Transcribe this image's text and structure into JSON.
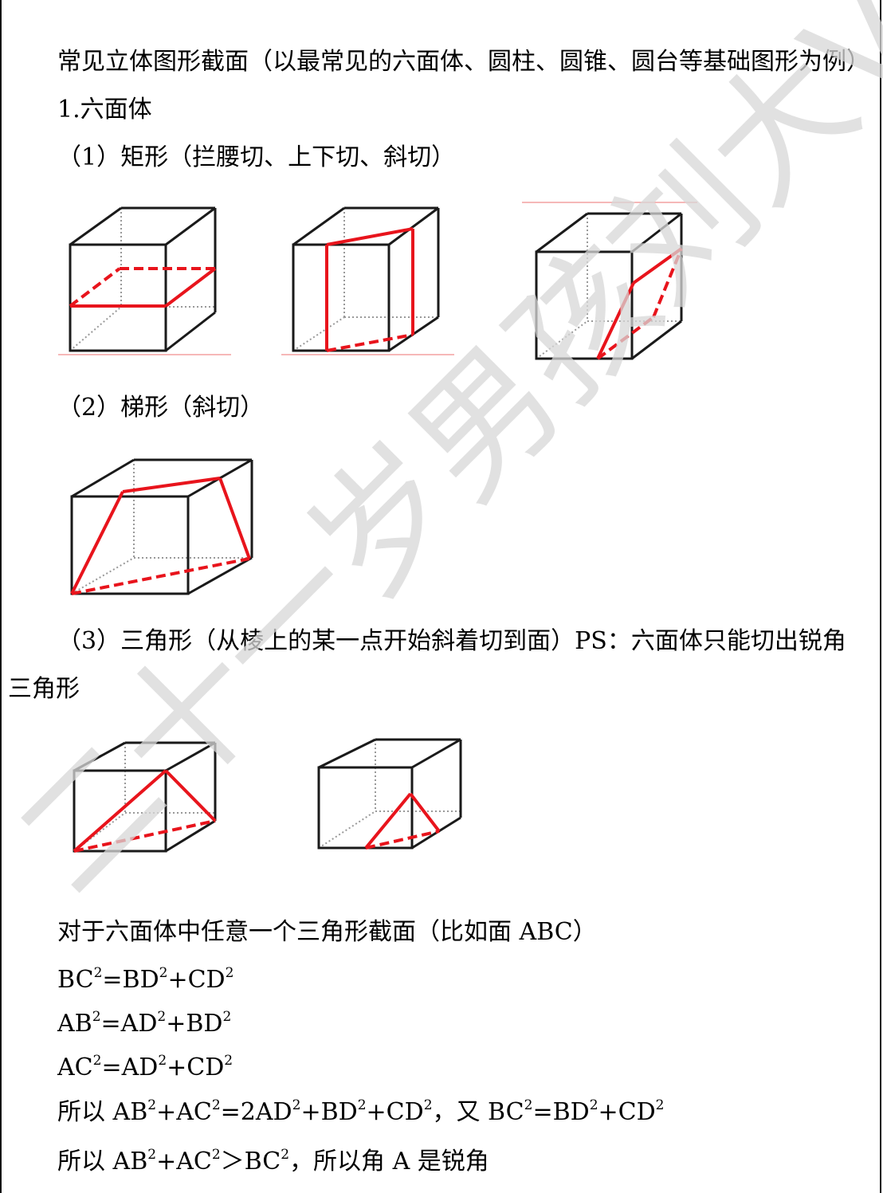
{
  "doc": {
    "title": "常见立体图形截面（以最常见的六面体、圆柱、圆锥、圆台等基础图形为例）",
    "section1": "1.六面体",
    "sub1": "（1）矩形（拦腰切、上下切、斜切）",
    "sub2": "（2）梯形（斜切）",
    "sub3_line1": "（3）三角形（从棱上的某一点开始斜着切到面）PS：六面体只能切出锐角",
    "sub3_line2": "三角形",
    "proof_intro": "对于六面体中任意一个三角形截面（比如面 ABC）",
    "eq1": [
      "BC",
      "2",
      "=BD",
      "2",
      "+CD",
      "2"
    ],
    "eq2": [
      "AB",
      "2",
      "=AD",
      "2",
      "+BD",
      "2"
    ],
    "eq3": [
      "AC",
      "2",
      "=AD",
      "2",
      "+CD",
      "2"
    ],
    "eq4": [
      "所以 AB",
      "2",
      "+AC",
      "2",
      "=2AD",
      "2",
      "+BD",
      "2",
      "+CD",
      "2",
      "，又 BC",
      "2",
      "=BD",
      "2",
      "+CD",
      "2"
    ],
    "eq5": [
      "所以 AB",
      "2",
      "+AC",
      "2",
      "＞BC",
      "2",
      "，所以角 A 是锐角"
    ]
  },
  "watermark": "二十一岁男孩刘大Vin",
  "colors": {
    "cut": "#e8141c",
    "edge": "#1a1a1a",
    "hidden": "#8a8a8a",
    "watermark": "#d8d8d8"
  }
}
